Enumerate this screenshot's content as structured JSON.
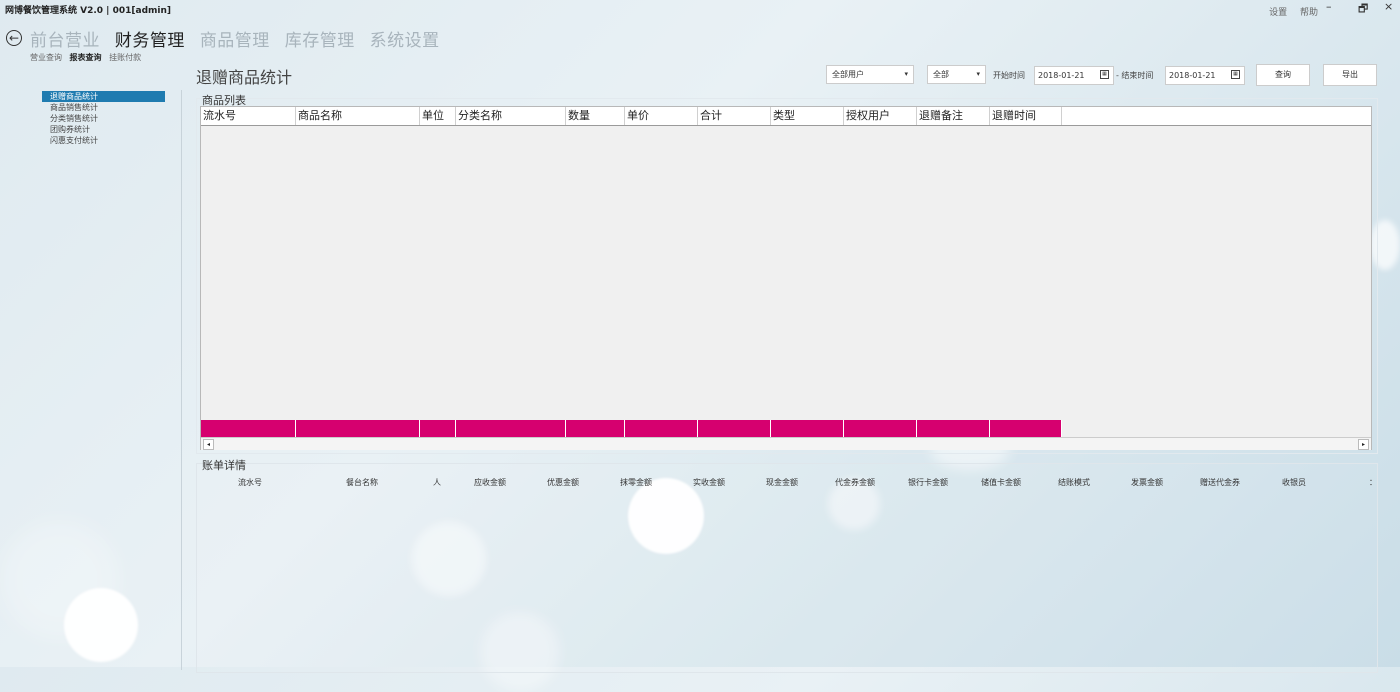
{
  "app": {
    "title": "网博餐饮管理系统 V2.0 | 001[admin]",
    "settings": "设置",
    "help": "帮助",
    "minimize": "–",
    "restore": "🗗",
    "close": "×"
  },
  "nav": {
    "back": "←",
    "items": [
      "前台营业",
      "财务管理",
      "商品管理",
      "库存管理",
      "系统设置"
    ],
    "active_index": 1
  },
  "subnav": {
    "items": [
      "营业查询",
      "报表查询",
      "挂账付款"
    ],
    "active_index": 1
  },
  "sidebar": {
    "items": [
      "退赠商品统计",
      "商品销售统计",
      "分类销售统计",
      "团购券统计",
      "闪惠支付统计"
    ],
    "active_index": 0
  },
  "page": {
    "title": "退赠商品统计"
  },
  "filters": {
    "user_select": "全部用户",
    "type_select": "全部",
    "arrow": "▾",
    "start_label": "开始时间",
    "start_date": "2018-01-21",
    "end_label": "- 结束时间",
    "end_date": "2018-01-21",
    "cal_icon": "▦",
    "query_btn": "查询",
    "export_btn": "导出"
  },
  "product_list": {
    "label": "商品列表",
    "columns": [
      "流水号",
      "商品名称",
      "单位",
      "分类名称",
      "数量",
      "单价",
      "合计",
      "类型",
      "授权用户",
      "退赠备注",
      "退赠时间"
    ],
    "rows": [],
    "scroll_left": "◂",
    "scroll_right": "▸"
  },
  "bill_detail": {
    "label": "账单详情",
    "columns": [
      "流水号",
      "餐台名称",
      "人",
      "应收金额",
      "优惠金额",
      "抹零金额",
      "实收金额",
      "现金金额",
      "代金券金额",
      "银行卡金额",
      "储值卡金额",
      "结账模式",
      "发票金额",
      "赠送代金券",
      "收银员",
      "："
    ],
    "rows": []
  },
  "colors": {
    "accent": "#1f7bb0",
    "summary_row": "#d6006f"
  }
}
